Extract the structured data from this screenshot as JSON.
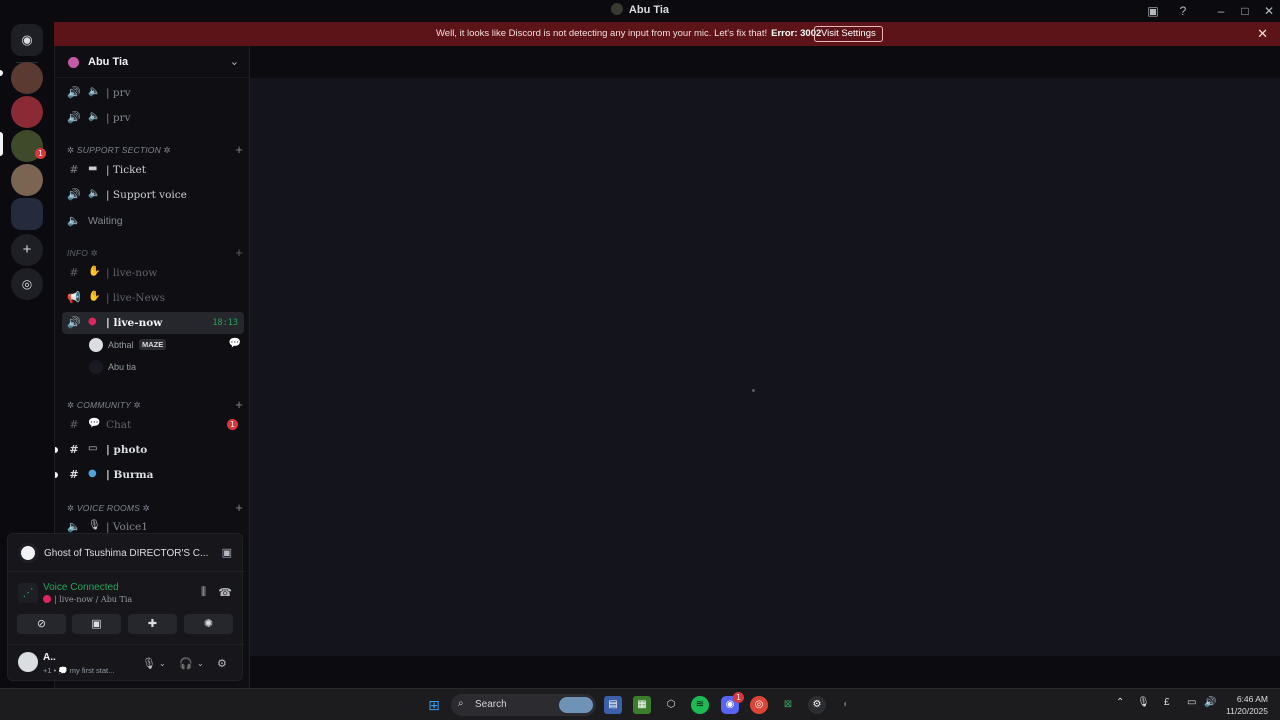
{
  "window": {
    "title": "Abu Tia"
  },
  "banner": {
    "message": "Well, it looks like Discord is not detecting any input from your mic. Let's fix that!",
    "error": "Error: 3002",
    "button": "Visit Settings"
  },
  "server": {
    "name": "Abu Tia"
  },
  "channels": {
    "prv1": "| prv",
    "prv2": "| prv",
    "cat_support": "✲ SUPPORT SECTION ✲",
    "ticket": "| Ticket",
    "support_voice": "| Support voice",
    "waiting": "Waiting",
    "cat_info": "INFO ✲",
    "live_now_text": "| live-now",
    "live_news": "| live-News",
    "live_now_voice": "| live-now",
    "live_timer": "18:13",
    "cat_community": "✲ COMMUNITY ✲",
    "chat": "Chat",
    "chat_badge": "1",
    "photo": "| photo",
    "burma": "| Burma",
    "cat_voice_rooms": "✲ VOICE ROOMS ✲",
    "voice1": "| Voice1"
  },
  "voice_users": [
    {
      "name": "Abthal",
      "tag": "MAZE"
    },
    {
      "name": "Abu tia"
    }
  ],
  "activity": {
    "game": "Ghost of Tsushima DIRECTOR'S C..."
  },
  "voice_connection": {
    "status": "Voice Connected",
    "channel": "| live-now / Abu Tia"
  },
  "user": {
    "name": "A..",
    "status": "+1 • 💭 my first stat..."
  },
  "taskbar": {
    "search_label": "Search",
    "discord_badge": "1",
    "time": "6:46 AM",
    "date": "11/20/2025",
    "lang": "£"
  },
  "colors": {
    "accent_green": "#23a55a",
    "error_red": "#da373c",
    "banner_bg": "#5c1419"
  }
}
